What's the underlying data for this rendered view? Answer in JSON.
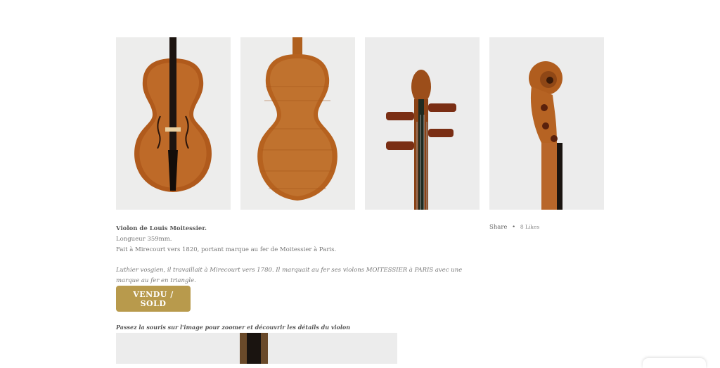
{
  "gallery": {
    "images": [
      {
        "view": "front"
      },
      {
        "view": "back"
      },
      {
        "view": "scroll-front"
      },
      {
        "view": "scroll-side"
      }
    ]
  },
  "product": {
    "title": "Violon de Louis Moitessier.",
    "length": "Longueur 359mm.",
    "origin": "Fait à Mirecourt vers 1820, portant marque au fer de Moitessier à Paris.",
    "note": "Luthier vosgien, il travaillait à Mirecourt vers 1780. Il marquait au fer ses violons MOITESSIER à PARIS avec une marque au fer en triangle."
  },
  "share": {
    "label": "Share",
    "separator": "•",
    "likes": "8 Likes"
  },
  "sold_button": {
    "label": "VENDU / SOLD",
    "color": "#b89a4c"
  },
  "zoom_hint": "Passez la souris sur l'image pour zoomer et découvrir les détails du violon"
}
